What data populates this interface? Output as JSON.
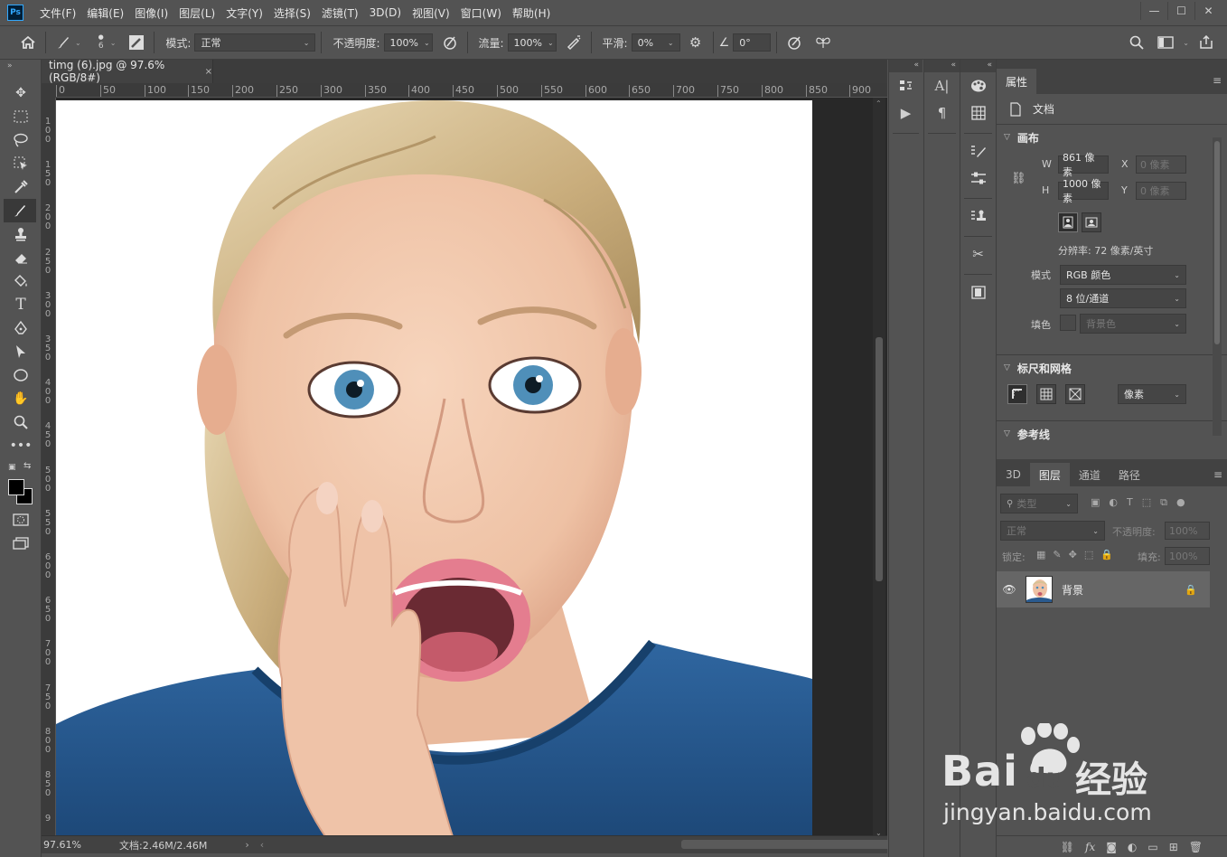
{
  "app": {
    "logo": "Ps"
  },
  "menu": [
    "文件(F)",
    "编辑(E)",
    "图像(I)",
    "图层(L)",
    "文字(Y)",
    "选择(S)",
    "滤镜(T)",
    "3D(D)",
    "视图(V)",
    "窗口(W)",
    "帮助(H)"
  ],
  "window_controls": {
    "minimize": "—",
    "maximize": "☐",
    "close": "✕"
  },
  "options": {
    "brush_size": "6",
    "mode_label": "模式:",
    "mode_value": "正常",
    "opacity_label": "不透明度:",
    "opacity_value": "100%",
    "flow_label": "流量:",
    "flow_value": "100%",
    "smoothing_label": "平滑:",
    "smoothing_value": "0%",
    "angle_value": "0°"
  },
  "document": {
    "tab_title": "timg (6).jpg @ 97.6%(RGB/8#)",
    "tab_close": "×",
    "ruler_h": [
      "0",
      "50",
      "100",
      "150",
      "200",
      "250",
      "300",
      "350",
      "400",
      "450",
      "500",
      "550",
      "600",
      "650",
      "700",
      "750",
      "800",
      "850",
      "900"
    ],
    "ruler_v": [
      "1\n0\n0",
      "1\n5\n0",
      "2\n0\n0",
      "2\n5\n0",
      "3\n0\n0",
      "3\n5\n0",
      "4\n0\n0",
      "4\n5\n0",
      "5\n0\n0",
      "5\n5\n0",
      "6\n0\n0",
      "6\n5\n0",
      "7\n0\n0",
      "7\n5\n0",
      "8\n0\n0",
      "8\n5\n0",
      "9"
    ],
    "zoom": "97.61%",
    "doc_info": "文档:2.46M/2.46M"
  },
  "properties": {
    "tab": "属性",
    "doc_label": "文档",
    "canvas_section": "画布",
    "w_label": "W",
    "w_value": "861 像素",
    "h_label": "H",
    "h_value": "1000 像素",
    "x_label": "X",
    "x_placeholder": "0 像素",
    "y_label": "Y",
    "y_placeholder": "0 像素",
    "resolution": "分辨率: 72 像素/英寸",
    "mode_label": "模式",
    "mode_value": "RGB 颜色",
    "depth_value": "8 位/通道",
    "fill_label": "填色",
    "fill_value": "背景色",
    "rulers_section": "标尺和网格",
    "units_value": "像素",
    "guides_section": "参考线"
  },
  "layers": {
    "tabs": [
      "3D",
      "图层",
      "通道",
      "路径"
    ],
    "active_tab": "图层",
    "filter_placeholder": "类型",
    "blend_value": "正常",
    "opacity_label": "不透明度:",
    "opacity_value": "100%",
    "lock_label": "锁定:",
    "fill_label": "填充:",
    "fill_value": "100%",
    "items": [
      {
        "name": "背景",
        "visible": true,
        "locked": true
      }
    ],
    "footer_icons": [
      "link-icon",
      "fx-icon",
      "mask-icon",
      "adjustment-icon",
      "group-icon",
      "new-layer-icon",
      "trash-icon"
    ],
    "fx_text": "fx"
  },
  "watermark": {
    "brand": "Bai",
    "brand_cn": "经验",
    "url": "jingyan.baidu.com"
  },
  "colors": {
    "ui_bg": "#535353",
    "canvas_bg": "#282828",
    "shirt": "#2a5a8e",
    "hair": "#d8c296",
    "skin": "#f2cbb2"
  }
}
